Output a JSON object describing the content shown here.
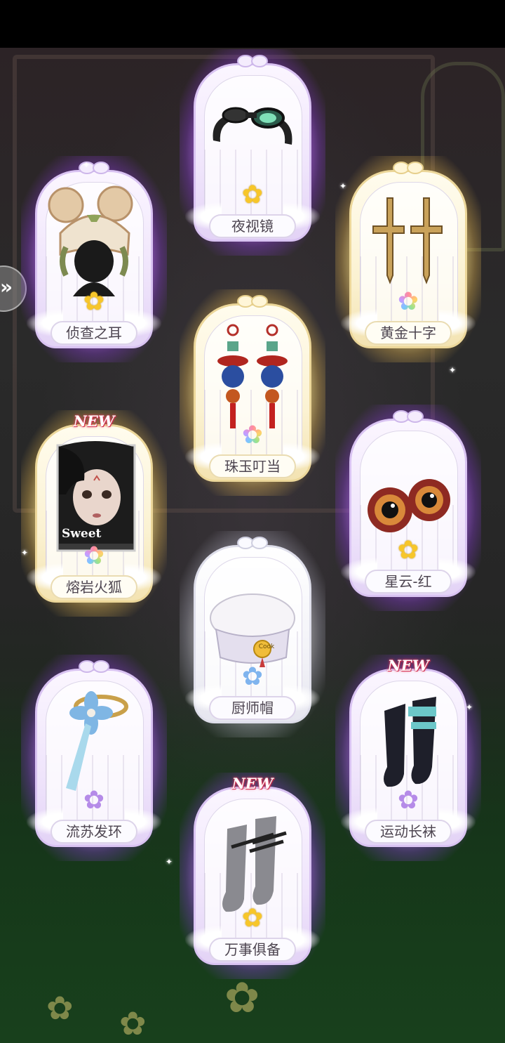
{
  "cards": [
    {
      "id": "ye-shi-jing",
      "name": "夜视镜",
      "rarity": "purple",
      "star": "yellow",
      "is_new": false
    },
    {
      "id": "zhen-cha-zhi-er",
      "name": "侦查之耳",
      "rarity": "purple",
      "star": "yellow",
      "is_new": false
    },
    {
      "id": "huang-jin-shi-zi",
      "name": "黄金十字",
      "rarity": "gold",
      "star": "rainbow",
      "is_new": false
    },
    {
      "id": "zhu-yu-ding-dang",
      "name": "珠玉叮当",
      "rarity": "gold",
      "star": "rainbow",
      "is_new": false
    },
    {
      "id": "rong-yan-huo-hu",
      "name": "熔岩火狐",
      "rarity": "gold",
      "star": "rainbow",
      "is_new": true,
      "portrait_text": "Sweet"
    },
    {
      "id": "xing-yun-hong",
      "name": "星云-红",
      "rarity": "purple",
      "star": "yellow",
      "is_new": false
    },
    {
      "id": "chu-shi-mao",
      "name": "厨师帽",
      "rarity": "white",
      "star": "blue",
      "is_new": false,
      "badge_text": "Cook"
    },
    {
      "id": "liu-su-fa-huan",
      "name": "流苏发环",
      "rarity": "purple",
      "star": "purple",
      "is_new": false
    },
    {
      "id": "yun-dong-chang-wa",
      "name": "运动长袜",
      "rarity": "purple",
      "star": "purple",
      "is_new": true
    },
    {
      "id": "wan-shi-ju-bei",
      "name": "万事俱备",
      "rarity": "purple",
      "star": "yellow",
      "is_new": true
    }
  ],
  "new_label": "NEW",
  "side_button_icon": "double-chevron-right-icon",
  "colors": {
    "purple_glow": "#b46cff",
    "gold_glow": "#ffe08a",
    "new_badge": "#e63d5c",
    "star_yellow": "#f7c62a"
  }
}
